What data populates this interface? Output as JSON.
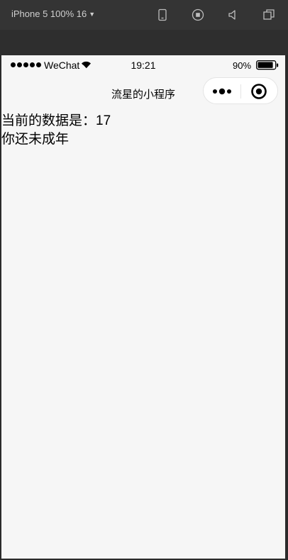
{
  "devtools": {
    "device_label": "iPhone 5 100% 16",
    "icons": [
      "phone-icon",
      "record-icon",
      "sound-icon",
      "window-icon"
    ]
  },
  "status_bar": {
    "carrier": "WeChat",
    "time": "19:21",
    "battery": "90%",
    "battery_level": 0.9
  },
  "nav": {
    "title": "流星的小程序",
    "more_icon": "more-dots-icon",
    "close_icon": "target-close-icon"
  },
  "content": {
    "data_line": "当前的数据是：17",
    "age_line": "你还未成年"
  }
}
